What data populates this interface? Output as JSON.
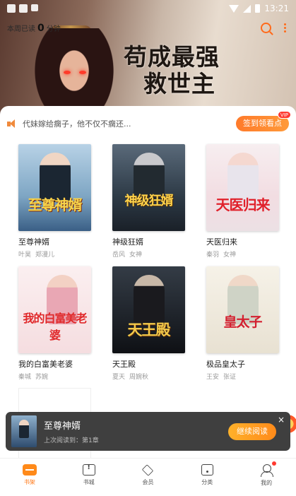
{
  "status_bar": {
    "time": "13:21"
  },
  "header": {
    "read_prefix": "本周已读",
    "read_minutes": "0",
    "read_suffix": "分钟",
    "banner_title_line1": "苟成最强",
    "banner_title_line2": "救世主",
    "search_icon": "search-icon",
    "more_icon": "more-vertical-icon"
  },
  "notice": {
    "text": "代妹嫁给瘸子，他不仅不瘸还...",
    "checkin_label": "签到领看点",
    "checkin_badge": "VIP"
  },
  "books": [
    {
      "title": "至尊神婿",
      "author": "叶昊",
      "tags": "郑漫儿",
      "cover_text": "至尊神婿"
    },
    {
      "title": "神级狂婿",
      "author": "岳风",
      "tags": "女神",
      "cover_text": "神级狂婿"
    },
    {
      "title": "天医归来",
      "author": "秦羽",
      "tags": "女神",
      "cover_text": "天医归来"
    },
    {
      "title": "我的白富美老婆",
      "author": "秦城",
      "tags": "苏婉",
      "cover_text": "我的白富美老婆"
    },
    {
      "title": "天王殿",
      "author": "夏天",
      "tags": "周婉秋",
      "cover_text": "天王殿"
    },
    {
      "title": "极品皇太子",
      "author": "王安",
      "tags": "张证",
      "cover_text": "皇太子"
    }
  ],
  "recent_read": {
    "title": "至尊神婿",
    "progress": "上次阅读到：第1章",
    "continue_label": "继续阅读",
    "close_label": "×"
  },
  "tabbar": {
    "items": [
      {
        "label": "书架",
        "icon": "bookshelf-icon",
        "active": true
      },
      {
        "label": "书城",
        "icon": "bookstore-icon",
        "active": false
      },
      {
        "label": "会员",
        "icon": "vip-diamond-icon",
        "active": false
      },
      {
        "label": "分类",
        "icon": "category-icon",
        "active": false
      },
      {
        "label": "我的",
        "icon": "profile-icon",
        "active": false
      }
    ]
  },
  "colors": {
    "accent": "#ff7a1a",
    "popup_bg": "#3f3f3f"
  }
}
